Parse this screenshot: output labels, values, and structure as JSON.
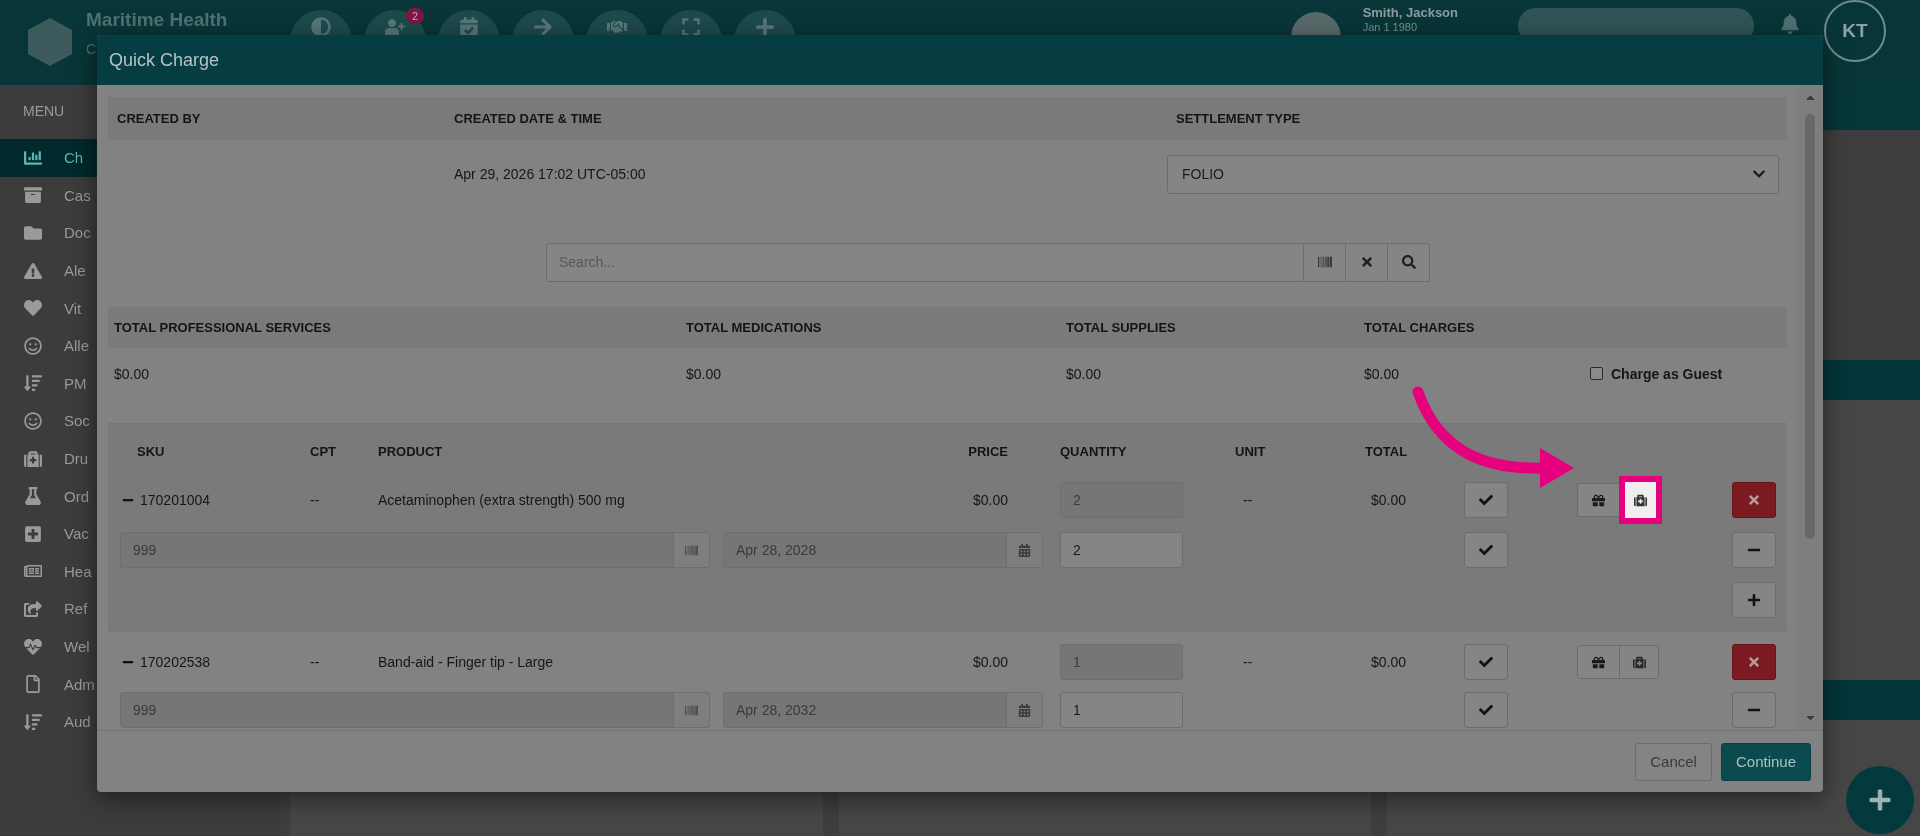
{
  "app": {
    "title": "Maritime Health",
    "subtitle": "C",
    "notification_count": "2"
  },
  "patient": {
    "name": "Smith, Jackson",
    "dob": "Jan 1 1980"
  },
  "user": {
    "initials": "KT"
  },
  "sidebar": {
    "title": "MENU",
    "items": [
      {
        "label": "Ch",
        "selected": true
      },
      {
        "label": "Cas",
        "selected": false
      },
      {
        "label": "Doc",
        "selected": false
      },
      {
        "label": "Ale",
        "selected": false
      },
      {
        "label": "Vit",
        "selected": false
      },
      {
        "label": "Alle",
        "selected": false
      },
      {
        "label": "PM",
        "selected": false
      },
      {
        "label": "Soc",
        "selected": false
      },
      {
        "label": "Dru",
        "selected": false
      },
      {
        "label": "Ord",
        "selected": false
      },
      {
        "label": "Vac",
        "selected": false
      },
      {
        "label": "Hea",
        "selected": false
      },
      {
        "label": "Ref",
        "selected": false
      },
      {
        "label": "Wel",
        "selected": false
      },
      {
        "label": "Adm",
        "selected": false
      },
      {
        "label": "Aud",
        "selected": false
      }
    ]
  },
  "modal": {
    "title": "Quick Charge",
    "info_columns": [
      "CREATED BY",
      "CREATED DATE & TIME",
      "SETTLEMENT TYPE"
    ],
    "created_date": "Apr 29, 2026 17:02 UTC-05:00",
    "settlement_type": "FOLIO",
    "search": {
      "placeholder": "Search..."
    },
    "totals": [
      {
        "label": "TOTAL PROFESSIONAL SERVICES",
        "value": "$0.00"
      },
      {
        "label": "TOTAL MEDICATIONS",
        "value": "$0.00"
      },
      {
        "label": "TOTAL SUPPLIES",
        "value": "$0.00"
      },
      {
        "label": "TOTAL CHARGES",
        "value": "$0.00"
      }
    ],
    "charge_as_guest": {
      "label": "Charge as Guest",
      "checked": false
    },
    "columns": [
      "SKU",
      "CPT",
      "PRODUCT",
      "PRICE",
      "QUANTITY",
      "UNIT",
      "TOTAL"
    ],
    "rows": [
      {
        "sku": "170201004",
        "cpt": "--",
        "product": "Acetaminophen (extra strength) 500 mg",
        "price": "$0.00",
        "quantity": "2",
        "unit": "--",
        "total": "$0.00",
        "lot": "999",
        "expiry": "Apr 28, 2028",
        "lot_quantity": "2",
        "can_add_lot": true,
        "kit_highlighted": true
      },
      {
        "sku": "170202538",
        "cpt": "--",
        "product": "Band-aid - Finger tip - Large",
        "price": "$0.00",
        "quantity": "1",
        "unit": "--",
        "total": "$0.00",
        "lot": "999",
        "expiry": "Apr 28, 2032",
        "lot_quantity": "1",
        "can_add_lot": false,
        "kit_highlighted": false
      }
    ],
    "buttons": {
      "cancel": "Cancel",
      "continue": "Continue"
    }
  }
}
